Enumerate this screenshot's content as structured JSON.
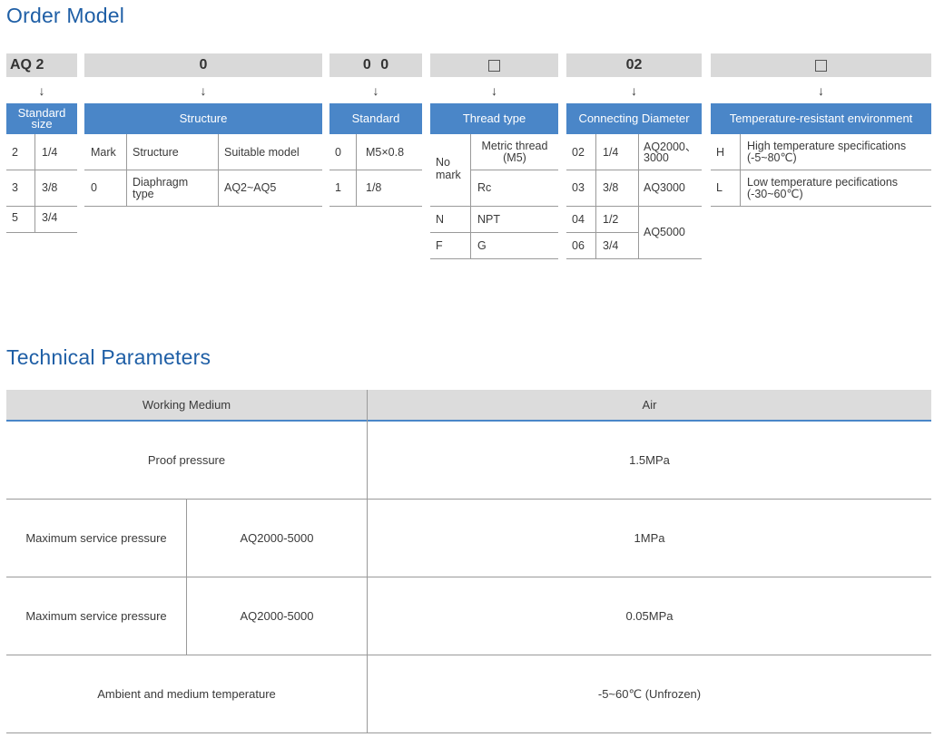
{
  "order_model": {
    "title": "Order Model",
    "codes": {
      "series": "AQ 2",
      "structure": "0",
      "standard": "0 0",
      "diameter": "02"
    },
    "arrow": "↓",
    "headers": {
      "size": "Standard size",
      "structure": "Structure",
      "standard": "Standard",
      "thread": "Thread type",
      "diameter": "Connecting Diameter",
      "temperature": "Temperature-resistant environment"
    },
    "size_rows": [
      {
        "code": "2",
        "value": "1/4"
      },
      {
        "code": "3",
        "value": "3/8"
      },
      {
        "code": "5",
        "value": "3/4"
      }
    ],
    "structure_table": {
      "col_mark": "Mark",
      "col_structure": "Structure",
      "col_model": "Suitable model",
      "row_mark": "0",
      "row_structure": "Diaphragm type",
      "row_model": "AQ2~AQ5"
    },
    "standard_rows": [
      {
        "code": "0",
        "value": "M5×0.8"
      },
      {
        "code": "1",
        "value": "1/8"
      }
    ],
    "thread_rows": {
      "no_mark": "No mark",
      "metric": "Metric thread (M5)",
      "rc": "Rc",
      "n_code": "N",
      "npt": "NPT",
      "f_code": "F",
      "g": "G"
    },
    "diameter_rows": {
      "r1_code": "02",
      "r1_size": "1/4",
      "r1_model": "AQ2000、3000",
      "r2_code": "03",
      "r2_size": "3/8",
      "r2_model": "AQ3000",
      "r3_code": "04",
      "r3_size": "1/2",
      "r4_code": "06",
      "r4_size": "3/4",
      "r34_model": "AQ5000"
    },
    "temperature_rows": {
      "h_code": "H",
      "h_desc": "High temperature specifications (-5~80℃)",
      "l_code": "L",
      "l_desc": "Low temperature pecifications (-30~60℃)"
    }
  },
  "technical": {
    "title": "Technical Parameters",
    "header_label": "Working Medium",
    "header_value": "Air",
    "proof_label": "Proof pressure",
    "proof_value": "1.5MPa",
    "max_label_1": "Maximum service pressure",
    "max_model_1": "AQ2000-5000",
    "max_value_1": "1MPa",
    "max_label_2": "Maximum service pressure",
    "max_model_2": "AQ2000-5000",
    "max_value_2": "0.05MPa",
    "temp_label": "Ambient and medium temperature",
    "temp_value": "-5~60℃ (Unfrozen)"
  },
  "colors": {
    "heading": "#1f5fa6",
    "header_blue": "#4a86c8",
    "code_gray": "#d9d9d9",
    "table_header_gray": "#dcdcdc",
    "accent_line": "#4a86c8"
  }
}
